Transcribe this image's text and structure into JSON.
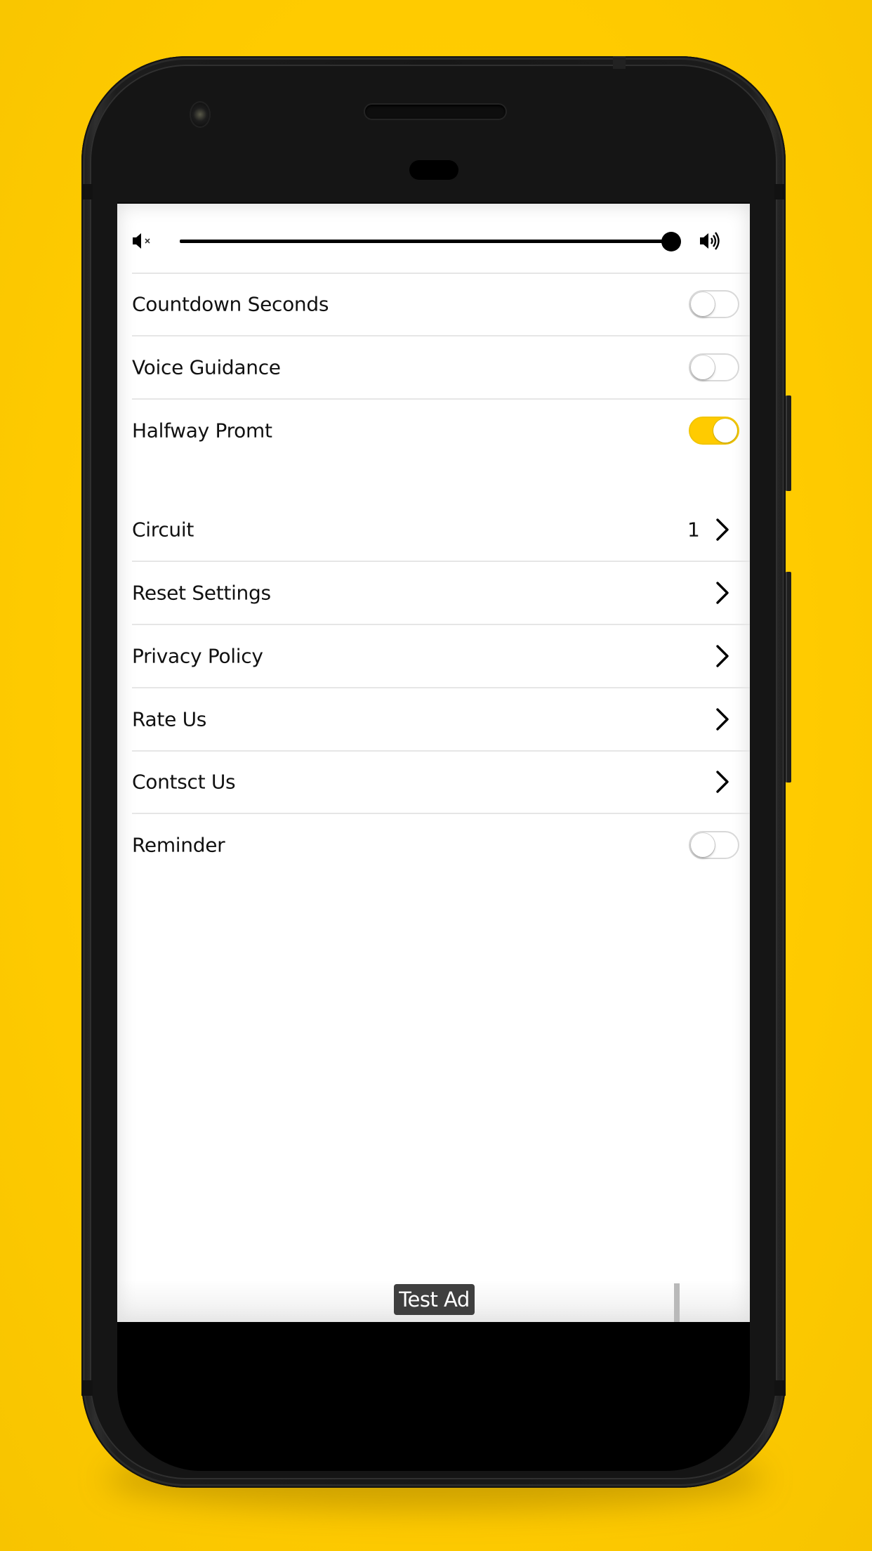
{
  "theme": {
    "background": "#FFCB00",
    "accent": "#FFCB00",
    "toggle_off": "#FFFFFF",
    "text": "#111111"
  },
  "volume": {
    "mute_icon": "volume-mute-icon",
    "max_icon": "volume-high-icon",
    "level_percent": 100
  },
  "settings": [
    {
      "label": "Countdown Seconds",
      "type": "toggle",
      "on": false
    },
    {
      "label": "Voice Guidance",
      "type": "toggle",
      "on": false
    },
    {
      "label": "Halfway Promt",
      "type": "toggle",
      "on": true
    },
    {
      "label": "Circuit",
      "type": "link",
      "value": "1",
      "icon": "chevron-right-icon"
    },
    {
      "label": "Reset Settings",
      "type": "link",
      "icon": "chevron-right-icon"
    },
    {
      "label": "Privacy Policy",
      "type": "link",
      "icon": "chevron-right-icon"
    },
    {
      "label": "Rate Us",
      "type": "link",
      "icon": "chevron-right-icon"
    },
    {
      "label": "Contsct Us",
      "type": "link",
      "icon": "chevron-right-icon"
    },
    {
      "label": "Reminder",
      "type": "toggle",
      "on": false
    }
  ],
  "ad": {
    "label": "Test Ad"
  }
}
